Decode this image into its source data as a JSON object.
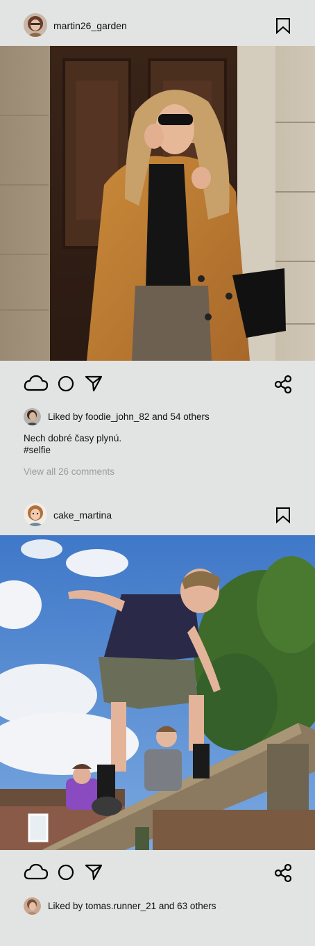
{
  "posts": [
    {
      "username": "martin26_garden",
      "liked_by_prefix": "Liked by",
      "liked_by_user": "foodie_john_82",
      "liked_by_suffix": "and 54 others",
      "caption_line1": "Nech dobré časy plynú.",
      "caption_hashtag": "#selfie",
      "comments_link": "View all 26 comments"
    },
    {
      "username": "cake_martina",
      "liked_by_prefix": "Liked by",
      "liked_by_user": "tomas.runner_21",
      "liked_by_suffix": "and 63 others"
    }
  ],
  "icons": {
    "like": "cloud-icon",
    "comment": "circle-icon",
    "send": "send-icon",
    "share": "share-icon",
    "save": "bookmark-icon"
  },
  "colors": {
    "background": "#e2e4e3",
    "muted_text": "#9a9c9b"
  }
}
